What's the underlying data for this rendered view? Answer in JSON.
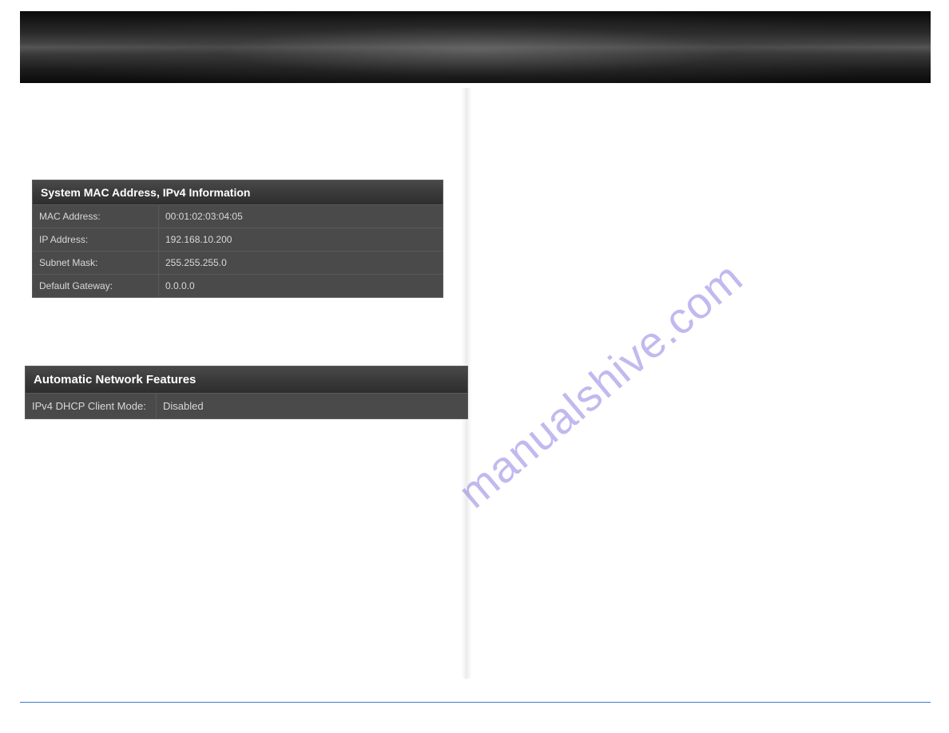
{
  "watermark": "manualshive.com",
  "panels": {
    "system_info": {
      "title": "System MAC Address, IPv4 Information",
      "rows": [
        {
          "label": "MAC Address:",
          "value": "00:01:02:03:04:05"
        },
        {
          "label": "IP Address:",
          "value": "192.168.10.200"
        },
        {
          "label": "Subnet Mask:",
          "value": "255.255.255.0"
        },
        {
          "label": "Default Gateway:",
          "value": "0.0.0.0"
        }
      ]
    },
    "auto_features": {
      "title": "Automatic Network Features",
      "rows": [
        {
          "label": "IPv4 DHCP Client Mode:",
          "value": "Disabled"
        }
      ]
    }
  }
}
